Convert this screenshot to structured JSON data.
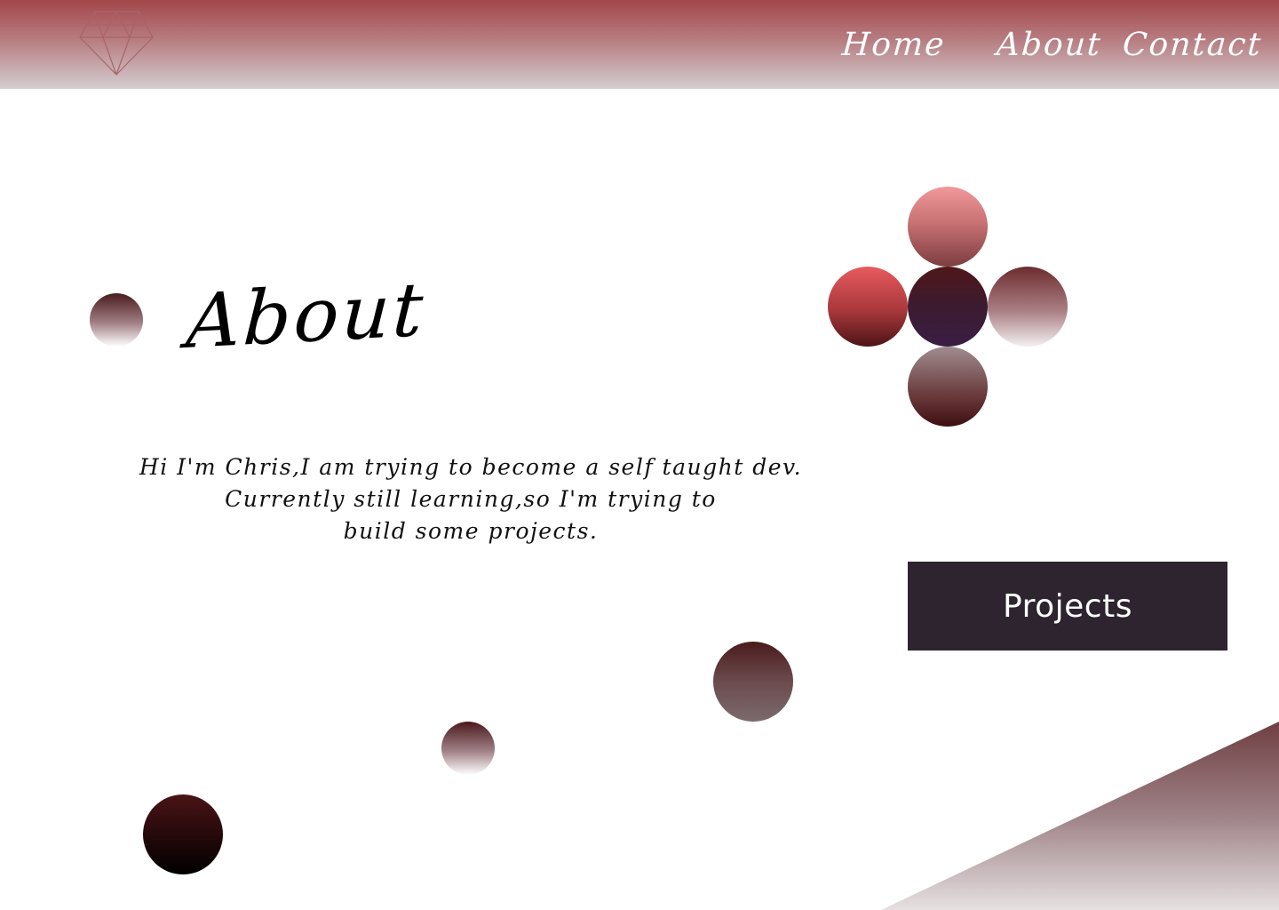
{
  "header": {
    "logo_icon": "diamond-icon",
    "nav": [
      {
        "label": "Home"
      },
      {
        "label": "About"
      },
      {
        "label": "Contact"
      }
    ]
  },
  "main": {
    "title": "About",
    "intro_lines": [
      "Hi I'm Chris,I am trying to become a self taught dev.",
      "Currently still learning,so I'm trying to",
      "build some projects."
    ],
    "projects_button": "Projects"
  },
  "colors": {
    "header_top": "#a3464a",
    "header_bottom": "#d4cdd0",
    "button_bg": "#2d2430",
    "text": "#000000"
  }
}
